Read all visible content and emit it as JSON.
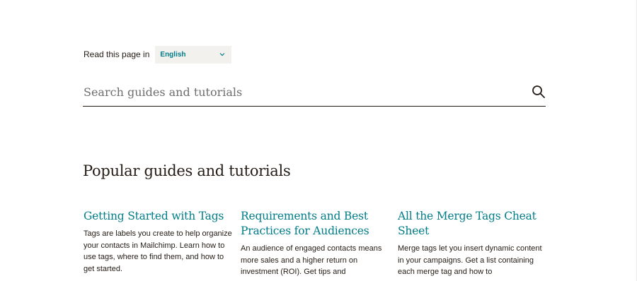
{
  "language": {
    "label": "Read this page in",
    "selected": "English"
  },
  "search": {
    "placeholder": "Search guides and tutorials"
  },
  "section": {
    "title": "Popular guides and tutorials"
  },
  "cards": [
    {
      "title": "Getting Started with Tags",
      "description": "Tags are labels you create to help organize your contacts in Mailchimp. Learn how to use tags, where to find them, and how to get started."
    },
    {
      "title": "Requirements and Best Practices for Audiences",
      "description": "An audience of engaged contacts means more sales and a higher return on investment (ROI). Get tips and"
    },
    {
      "title": "All the Merge Tags Cheat Sheet",
      "description": "Merge tags let you insert dynamic content in your campaigns. Get a list containing each merge tag and how to"
    }
  ],
  "colors": {
    "link": "#007c89",
    "text": "#241c15",
    "select_bg": "#f3f1ee"
  },
  "icons": {
    "search": "search-icon",
    "dropdown": "chevron-down-icon"
  }
}
